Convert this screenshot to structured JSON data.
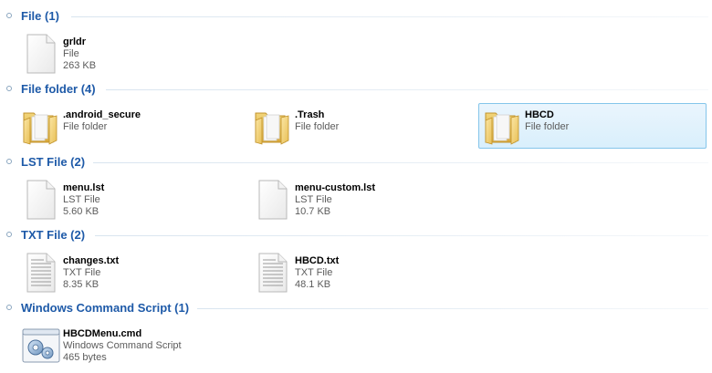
{
  "groups": [
    {
      "title": "File (1)"
    },
    {
      "title": "File folder (4)"
    },
    {
      "title": "LST File (2)"
    },
    {
      "title": "TXT File (2)"
    },
    {
      "title": "Windows Command Script (1)"
    }
  ],
  "items": [
    {
      "name": "grldr",
      "type": "File",
      "size": "263 KB",
      "icon": "blank-file-icon"
    },
    {
      "name": ".android_secure",
      "type": "File folder",
      "icon": "folder-icon"
    },
    {
      "name": ".Trash",
      "type": "File folder",
      "icon": "folder-icon"
    },
    {
      "name": "HBCD",
      "type": "File folder",
      "icon": "folder-icon"
    },
    {
      "name": "menu.lst",
      "type": "LST File",
      "size": "5.60 KB",
      "icon": "blank-file-icon"
    },
    {
      "name": "menu-custom.lst",
      "type": "LST File",
      "size": "10.7 KB",
      "icon": "blank-file-icon"
    },
    {
      "name": "changes.txt",
      "type": "TXT File",
      "size": "8.35 KB",
      "icon": "text-file-icon"
    },
    {
      "name": "HBCD.txt",
      "type": "TXT File",
      "size": "48.1 KB",
      "icon": "text-file-icon"
    },
    {
      "name": "HBCDMenu.cmd",
      "type": "Windows Command Script",
      "size": "465 bytes",
      "icon": "script-gear-icon"
    }
  ]
}
